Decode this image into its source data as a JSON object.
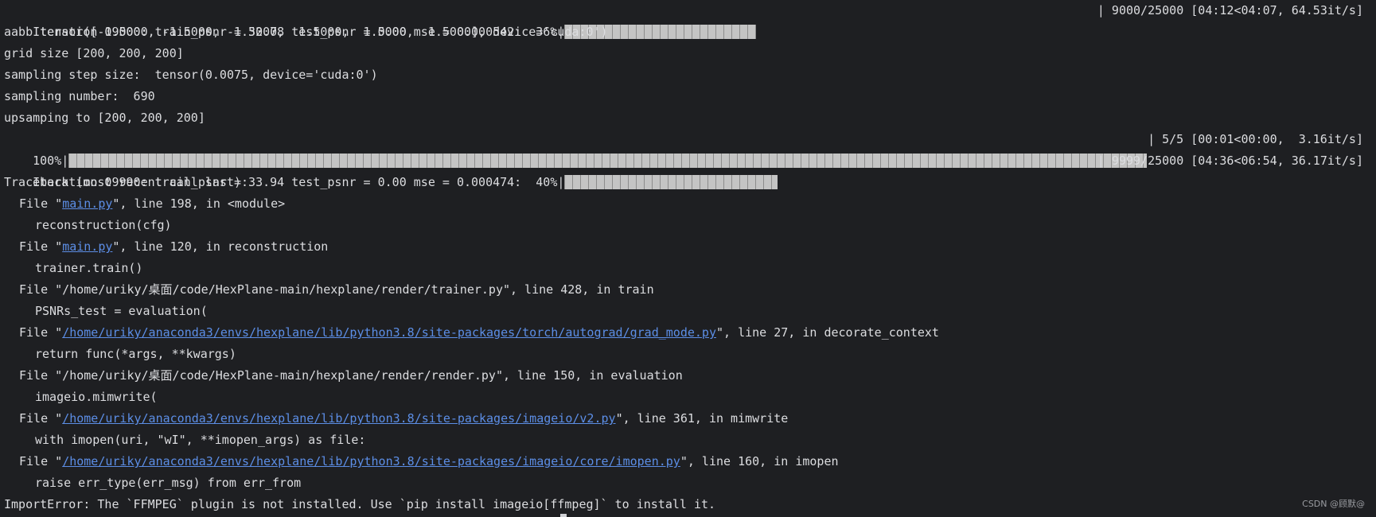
{
  "terminal": {
    "iter1": {
      "text": "Iteration 09000: train_psnr = 32.78 test_psnr = 0.00 mse = 0.000542:  36%|",
      "progress": 0.36,
      "stats": "| 9000/25000 [04:12<04:07, 64.53it/s]"
    },
    "aabb": "aabb tensor([-1.5000, -1.5000, -1.5000,  1.5000,  1.5000,  1.5000], device='cuda:0')",
    "grid_size": "grid size [200, 200, 200]",
    "sampling_step": "sampling step size:  tensor(0.0075, device='cuda:0')",
    "sampling_number": "sampling number:  690",
    "upsamping": "upsamping to [200, 200, 200]",
    "render_progress": {
      "text": "100%|",
      "progress": 1.0,
      "stats": "| 5/5 [00:01<00:00,  3.16it/s]"
    },
    "iter2": {
      "text": "Iteration 09990: train_psnr = 33.94 test_psnr = 0.00 mse = 0.000474:  40%|",
      "progress": 0.4,
      "stats": "| 9999/25000 [04:36<06:54, 36.17it/s]"
    },
    "traceback_header": "Traceback (most recent call last):",
    "frames": [
      {
        "pre": "File \"",
        "path": "main.py",
        "post": "\", line 198, in <module>",
        "code": "reconstruction(cfg)"
      },
      {
        "pre": "File \"",
        "path": "main.py",
        "post": "\", line 120, in reconstruction",
        "code": "trainer.train()"
      },
      {
        "pre": "File \"/home/uriky/桌面/code/HexPlane-main/hexplane/render/trainer.py\", line 428, in train",
        "code": "PSNRs_test = evaluation("
      },
      {
        "pre": "File \"",
        "path": "/home/uriky/anaconda3/envs/hexplane/lib/python3.8/site-packages/torch/autograd/grad_mode.py",
        "post": "\", line 27, in decorate_context",
        "code": "return func(*args, **kwargs)"
      },
      {
        "pre": "File \"/home/uriky/桌面/code/HexPlane-main/hexplane/render/render.py\", line 150, in evaluation",
        "code": "imageio.mimwrite("
      },
      {
        "pre": "File \"",
        "path": "/home/uriky/anaconda3/envs/hexplane/lib/python3.8/site-packages/imageio/v2.py",
        "post": "\", line 361, in mimwrite",
        "code": "with imopen(uri, \"wI\", **imopen_args) as file:"
      },
      {
        "pre": "File \"",
        "path": "/home/uriky/anaconda3/envs/hexplane/lib/python3.8/site-packages/imageio/core/imopen.py",
        "post": "\", line 160, in imopen",
        "code": "raise err_type(err_msg) from err_from"
      }
    ],
    "error": "ImportError: The `FFMPEG` plugin is not installed. Use `pip install imageio[ffmpeg]` to install it.",
    "watermark": "CSDN @顾默@"
  },
  "colors": {
    "background": "#1e1f22",
    "text": "#dcdde0",
    "link": "#5c8ee6"
  }
}
